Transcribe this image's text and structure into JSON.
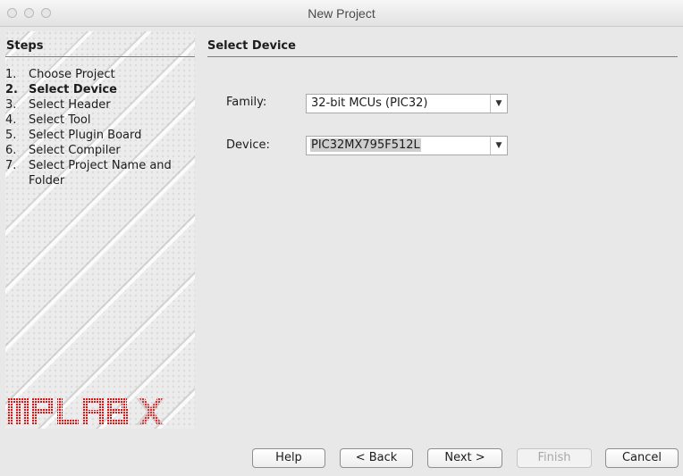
{
  "window": {
    "title": "New Project"
  },
  "steps": {
    "title": "Steps",
    "items": [
      {
        "num": "1.",
        "label": "Choose Project",
        "active": false
      },
      {
        "num": "2.",
        "label": "Select Device",
        "active": true
      },
      {
        "num": "3.",
        "label": "Select Header",
        "active": false
      },
      {
        "num": "4.",
        "label": "Select Tool",
        "active": false
      },
      {
        "num": "5.",
        "label": "Select Plugin Board",
        "active": false
      },
      {
        "num": "6.",
        "label": "Select Compiler",
        "active": false
      },
      {
        "num": "7.",
        "label": "Select Project Name and Folder",
        "active": false
      }
    ],
    "logo_text": "MPLAB X"
  },
  "content": {
    "title": "Select Device",
    "family": {
      "label": "Family:",
      "value": "32-bit MCUs (PIC32)"
    },
    "device": {
      "label": "Device:",
      "value": "PIC32MX795F512L"
    }
  },
  "buttons": {
    "help": "Help",
    "back": "< Back",
    "next": "Next >",
    "finish": "Finish",
    "cancel": "Cancel"
  },
  "icons": {
    "window_controls": [
      "close-icon",
      "minimize-icon",
      "zoom-icon"
    ],
    "dropdown": "chevron-down-icon"
  }
}
